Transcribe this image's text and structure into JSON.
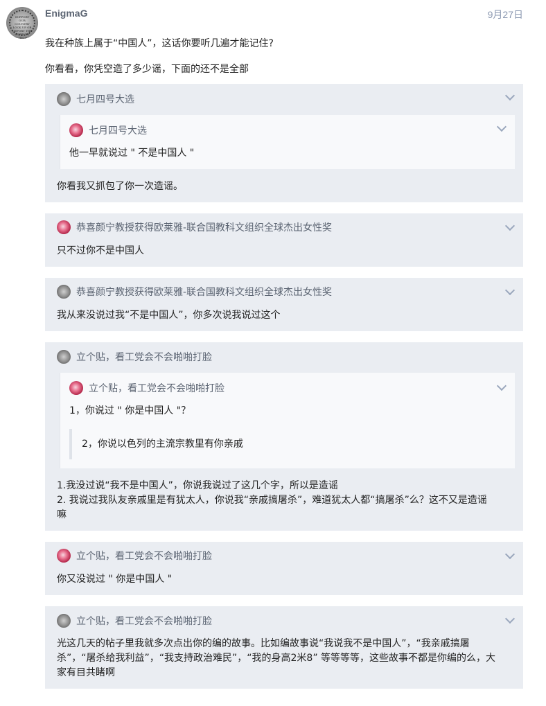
{
  "post": {
    "username": "EnigmaG",
    "date": "9月27日",
    "avatar_text": "SUPPORT OUR COUNTRY LOCK UP OR DEPORT THE CORRUPT POLITICIANS",
    "paragraphs": [
      "我在种族上属于“中国人”，这话你要听几遍才能记住?",
      "你看看，你凭空造了多少谣，下面的还不是全部"
    ]
  },
  "quotes": [
    {
      "author": "七月四号大选",
      "inner": {
        "author": "七月四号大选",
        "text": "他一早就说过 \" 不是中国人 \""
      },
      "text": "你看我又抓包了你一次造谣。"
    },
    {
      "author": "恭喜颜宁教授获得欧莱雅-联合国教科文组织全球杰出女性奖",
      "text": "只不过你不是中国人"
    },
    {
      "author": "恭喜颜宁教授获得欧莱雅-联合国教科文组织全球杰出女性奖",
      "text": "我从来没说过我“不是中国人”，你多次说我说过这个"
    },
    {
      "author": "立个贴，看工党会不会啪啪打脸",
      "inner": {
        "author": "立个贴，看工党会不会啪啪打脸",
        "text": "1，你说过 \" 你是中国人 \"？",
        "blockquote": "2，你说以色列的主流宗教里有你亲戚"
      },
      "lines": [
        "1.我没过说“我不是中国人”，你说我说过了这几个字，所以是造谣",
        "2. 我说过我队友亲戚里是有犹太人，你说我“亲戚搞屠杀”，难道犹太人都“搞屠杀”么？这不又是造谣",
        "嘛"
      ]
    },
    {
      "author": "立个贴，看工党会不会啪啪打脸",
      "text": "你又没说过 \" 你是中国人 \""
    },
    {
      "author": "立个贴，看工党会不会啪啪打脸",
      "lines": [
        "光这几天的帖子里我就多次点出你的编的故事。比如编故事说“我说我不是中国人”，“我亲戚搞屠",
        "杀”，“屠杀给我利益”，“我支持政治难民”，“我的身高2米8” 等等等等，这些故事不都是你编的么，大",
        "家有目共睹啊"
      ]
    }
  ]
}
